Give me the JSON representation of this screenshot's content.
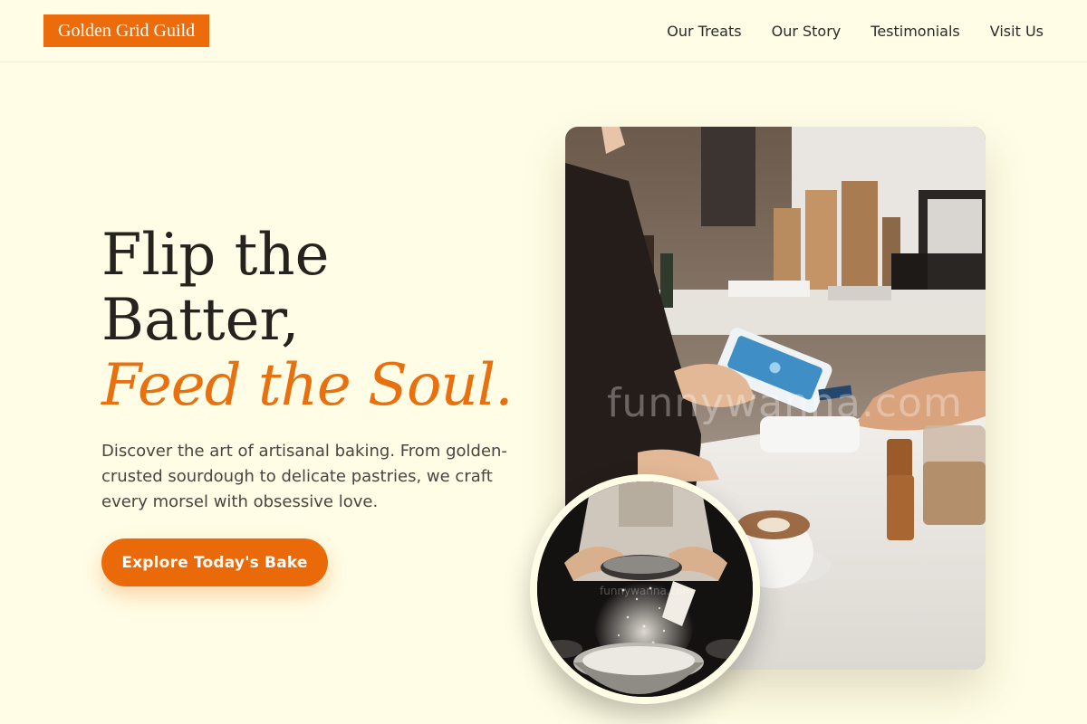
{
  "header": {
    "logo_text": "Golden Grid Guild",
    "nav": [
      "Our Treats",
      "Our Story",
      "Testimonials",
      "Visit Us"
    ]
  },
  "hero": {
    "title_line1": "Flip the",
    "title_line2": "Batter,",
    "title_accent": "Feed the Soul.",
    "description": "Discover the art of artisanal baking. From golden-crusted sourdough to delicate pastries, we craft every morsel with obsessive love.",
    "cta_label": "Explore Today's Bake"
  },
  "images": {
    "main_watermark": "funnywanna.com",
    "circle_watermark": "funnywanna.com"
  },
  "colors": {
    "background": "#fffde6",
    "accent": "#ec6c0c",
    "text": "#26221e"
  }
}
